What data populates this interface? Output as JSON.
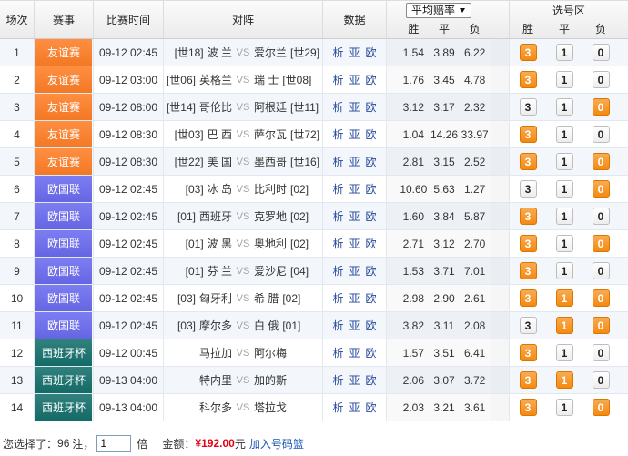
{
  "header": {
    "no": "场次",
    "league": "赛事",
    "time": "比赛时间",
    "match": "对阵",
    "data": "数据",
    "odds_select": "平均赔率",
    "odds_select_icon": "chevron-down-icon",
    "odds_sub": [
      "胜",
      "平",
      "负"
    ],
    "pick_title": "选号区",
    "pick_sub": [
      "胜",
      "平",
      "负"
    ]
  },
  "vs_label": "VS",
  "data_links": [
    "析",
    "亚",
    "欧"
  ],
  "pick_labels": [
    "3",
    "1",
    "0"
  ],
  "colors": {
    "badge": {
      "友谊赛": "#FF7F27",
      "欧国联": "#6B6BF0",
      "西班牙杯": "#15706C"
    },
    "pick_selected": "#F58A10",
    "price": "#E60012"
  },
  "matches": [
    {
      "no": "1",
      "league": "友谊赛",
      "time": "09-12 02:45",
      "home_rank": "[世18]",
      "home": "波 兰",
      "away": "爱尔兰",
      "away_rank": "[世29]",
      "odds": [
        "1.54",
        "3.89",
        "6.22"
      ],
      "selected": [
        true,
        false,
        false
      ]
    },
    {
      "no": "2",
      "league": "友谊赛",
      "time": "09-12 03:00",
      "home_rank": "[世06]",
      "home": "英格兰",
      "away": "瑞 士",
      "away_rank": "[世08]",
      "odds": [
        "1.76",
        "3.45",
        "4.78"
      ],
      "selected": [
        true,
        false,
        false
      ]
    },
    {
      "no": "3",
      "league": "友谊赛",
      "time": "09-12 08:00",
      "home_rank": "[世14]",
      "home": "哥伦比",
      "away": "阿根廷",
      "away_rank": "[世11]",
      "odds": [
        "3.12",
        "3.17",
        "2.32"
      ],
      "selected": [
        false,
        false,
        true
      ]
    },
    {
      "no": "4",
      "league": "友谊赛",
      "time": "09-12 08:30",
      "home_rank": "[世03]",
      "home": "巴 西",
      "away": "萨尔瓦",
      "away_rank": "[世72]",
      "odds": [
        "1.04",
        "14.26",
        "33.97"
      ],
      "selected": [
        true,
        false,
        false
      ]
    },
    {
      "no": "5",
      "league": "友谊赛",
      "time": "09-12 08:30",
      "home_rank": "[世22]",
      "home": "美 国",
      "away": "墨西哥",
      "away_rank": "[世16]",
      "odds": [
        "2.81",
        "3.15",
        "2.52"
      ],
      "selected": [
        true,
        false,
        true
      ]
    },
    {
      "no": "6",
      "league": "欧国联",
      "time": "09-12 02:45",
      "home_rank": "[03]",
      "home": "冰 岛",
      "away": "比利时",
      "away_rank": "[02]",
      "odds": [
        "10.60",
        "5.63",
        "1.27"
      ],
      "selected": [
        false,
        false,
        true
      ]
    },
    {
      "no": "7",
      "league": "欧国联",
      "time": "09-12 02:45",
      "home_rank": "[01]",
      "home": "西班牙",
      "away": "克罗地",
      "away_rank": "[02]",
      "odds": [
        "1.60",
        "3.84",
        "5.87"
      ],
      "selected": [
        true,
        false,
        false
      ]
    },
    {
      "no": "8",
      "league": "欧国联",
      "time": "09-12 02:45",
      "home_rank": "[01]",
      "home": "波 黑",
      "away": "奥地利",
      "away_rank": "[02]",
      "odds": [
        "2.71",
        "3.12",
        "2.70"
      ],
      "selected": [
        true,
        false,
        true
      ]
    },
    {
      "no": "9",
      "league": "欧国联",
      "time": "09-12 02:45",
      "home_rank": "[01]",
      "home": "芬 兰",
      "away": "爱沙尼",
      "away_rank": "[04]",
      "odds": [
        "1.53",
        "3.71",
        "7.01"
      ],
      "selected": [
        true,
        false,
        false
      ]
    },
    {
      "no": "10",
      "league": "欧国联",
      "time": "09-12 02:45",
      "home_rank": "[03]",
      "home": "匈牙利",
      "away": "希 腊",
      "away_rank": "[02]",
      "odds": [
        "2.98",
        "2.90",
        "2.61"
      ],
      "selected": [
        true,
        true,
        true
      ]
    },
    {
      "no": "11",
      "league": "欧国联",
      "time": "09-12 02:45",
      "home_rank": "[03]",
      "home": "摩尔多",
      "away": "白 俄",
      "away_rank": "[01]",
      "odds": [
        "3.82",
        "3.11",
        "2.08"
      ],
      "selected": [
        false,
        true,
        true
      ]
    },
    {
      "no": "12",
      "league": "西班牙杯",
      "time": "09-12 00:45",
      "home": "马拉加",
      "away": "阿尔梅",
      "odds": [
        "1.57",
        "3.51",
        "6.41"
      ],
      "selected": [
        true,
        false,
        false
      ]
    },
    {
      "no": "13",
      "league": "西班牙杯",
      "time": "09-13 04:00",
      "home": "特内里",
      "away": "加的斯",
      "odds": [
        "2.06",
        "3.07",
        "3.72"
      ],
      "selected": [
        true,
        true,
        false
      ]
    },
    {
      "no": "14",
      "league": "西班牙杯",
      "time": "09-13 04:00",
      "home": "科尔多",
      "away": "塔拉戈",
      "odds": [
        "2.03",
        "3.21",
        "3.61"
      ],
      "selected": [
        true,
        false,
        true
      ]
    }
  ],
  "footer": {
    "selected_prefix": "您选择了：",
    "bet_count": "96",
    "bet_unit": "注，",
    "multiplier": "1",
    "multiplier_unit": "倍",
    "amount_label": "金额：",
    "amount": "¥192.00",
    "amount_unit": "元",
    "add_basket": "加入号码篮"
  }
}
